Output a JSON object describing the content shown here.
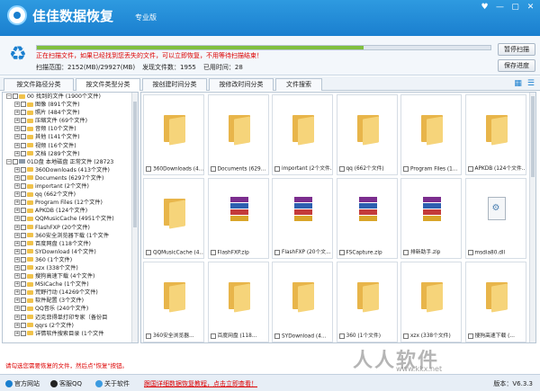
{
  "app": {
    "title": "佳佳数据恢复",
    "edition": "专业版",
    "window_buttons": [
      "♥",
      "—",
      "▢",
      "✕"
    ]
  },
  "scan": {
    "message": "正在扫描文件，如果已经找到您丢失的文件，可以立即恢复，不用等待扫描结束！",
    "progress": 0.72,
    "range": "扫描范围：2152(MB)/29927(MB)",
    "found": "发现文件数：1955",
    "elapsed": "已用时间：28",
    "pause_label": "暂停扫描",
    "save_label": "保存进度"
  },
  "tabs": [
    "按文件路径分类",
    "按文件类型分类",
    "按创建时间分类",
    "按修改时间分类",
    "文件搜索"
  ],
  "tree": [
    {
      "level": 0,
      "type": "folder",
      "label": "00 找到的文件   (1900个文件)"
    },
    {
      "level": 1,
      "type": "folder",
      "label": "图像       (891个文件)"
    },
    {
      "level": 1,
      "type": "folder",
      "label": "照片       (484个文件)"
    },
    {
      "level": 1,
      "type": "folder",
      "label": "压缩文件   (69个文件)"
    },
    {
      "level": 1,
      "type": "folder",
      "label": "音频       (10个文件)"
    },
    {
      "level": 1,
      "type": "folder",
      "label": "其他       (141个文件)"
    },
    {
      "level": 1,
      "type": "folder",
      "label": "视频       (16个文件)"
    },
    {
      "level": 1,
      "type": "folder",
      "label": "文档       (289个文件)"
    },
    {
      "level": 0,
      "type": "drive",
      "label": "01D盘 本地磁盘 正常文件  (28723"
    },
    {
      "level": 1,
      "type": "folder",
      "label": "360Downloads  (413个文件)"
    },
    {
      "level": 1,
      "type": "folder",
      "label": "Documents    (6297个文件)"
    },
    {
      "level": 1,
      "type": "folder",
      "label": "important    (2个文件)"
    },
    {
      "level": 1,
      "type": "folder",
      "label": "qq           (662个文件)"
    },
    {
      "level": 1,
      "type": "folder",
      "label": "Program Files (12个文件)"
    },
    {
      "level": 1,
      "type": "folder",
      "label": "APKDB        (124个文件)"
    },
    {
      "level": 1,
      "type": "folder",
      "label": "QQMusicCache (4951个文件)"
    },
    {
      "level": 1,
      "type": "folder",
      "label": "FlashFXP     (20个文件)"
    },
    {
      "level": 1,
      "type": "folder",
      "label": "360安全浏览器下载  (1个文件"
    },
    {
      "level": 1,
      "type": "folder",
      "label": "百度网盘     (118个文件)"
    },
    {
      "level": 1,
      "type": "folder",
      "label": "SYDownload   (4个文件)"
    },
    {
      "level": 1,
      "type": "folder",
      "label": "360          (1个文件)"
    },
    {
      "level": 1,
      "type": "folder",
      "label": "xzx          (338个文件)"
    },
    {
      "level": 1,
      "type": "folder",
      "label": "搜狗高速下载  (4个文件)"
    },
    {
      "level": 1,
      "type": "folder",
      "label": "MSICache     (1个文件)"
    },
    {
      "level": 1,
      "type": "folder",
      "label": "荒野行动     (14269个文件)"
    },
    {
      "level": 1,
      "type": "folder",
      "label": "软件配置     (3个文件)"
    },
    {
      "level": 1,
      "type": "folder",
      "label": "QQ音乐       (240个文件)"
    },
    {
      "level": 1,
      "type": "folder",
      "label": "迈克菲得单打印专家（备份目"
    },
    {
      "level": 1,
      "type": "folder",
      "label": "qqrs         (2个文件)"
    },
    {
      "level": 1,
      "type": "folder",
      "label": "详情软件搜索目录  (1个文件"
    }
  ],
  "grid": [
    {
      "kind": "folder",
      "label": "360Downloads (4..."
    },
    {
      "kind": "folder",
      "label": "Documents (629..."
    },
    {
      "kind": "folder",
      "label": "important (2个文件..."
    },
    {
      "kind": "folder",
      "label": "qq (662个文件)"
    },
    {
      "kind": "folder",
      "label": "Program Files (1..."
    },
    {
      "kind": "folder",
      "label": "APKDB (124个文件..."
    },
    {
      "kind": "folder",
      "label": "QQMusicCache (4..."
    },
    {
      "kind": "rar",
      "label": "FlashFXP.zip"
    },
    {
      "kind": "rar",
      "label": "FlashFXP (20个文..."
    },
    {
      "kind": "rar",
      "label": "FSCapture.zip"
    },
    {
      "kind": "rar",
      "label": "排新助手.zip"
    },
    {
      "kind": "dll",
      "label": "msdia80.dll"
    },
    {
      "kind": "folder",
      "label": "360安全浏览器..."
    },
    {
      "kind": "folder",
      "label": "百度网盘 (118..."
    },
    {
      "kind": "folder",
      "label": "SYDownload (4..."
    },
    {
      "kind": "folder",
      "label": "360 (1个文件)"
    },
    {
      "kind": "folder",
      "label": "xzx (338个文件)"
    },
    {
      "kind": "folder",
      "label": "搜狗高速下载 (..."
    }
  ],
  "status": {
    "hint": "请勾选您需要恢复的文件，然后点\"恢复\"按钮。"
  },
  "footer": {
    "website": "官方网站",
    "qq": "客服QQ",
    "about": "关于软件",
    "promo": "跟国详细数据恢复教程，点击立即查看！",
    "version": "版本：V6.3.3"
  },
  "watermark": {
    "text": "人人软件",
    "url": "www.kkx.net"
  }
}
